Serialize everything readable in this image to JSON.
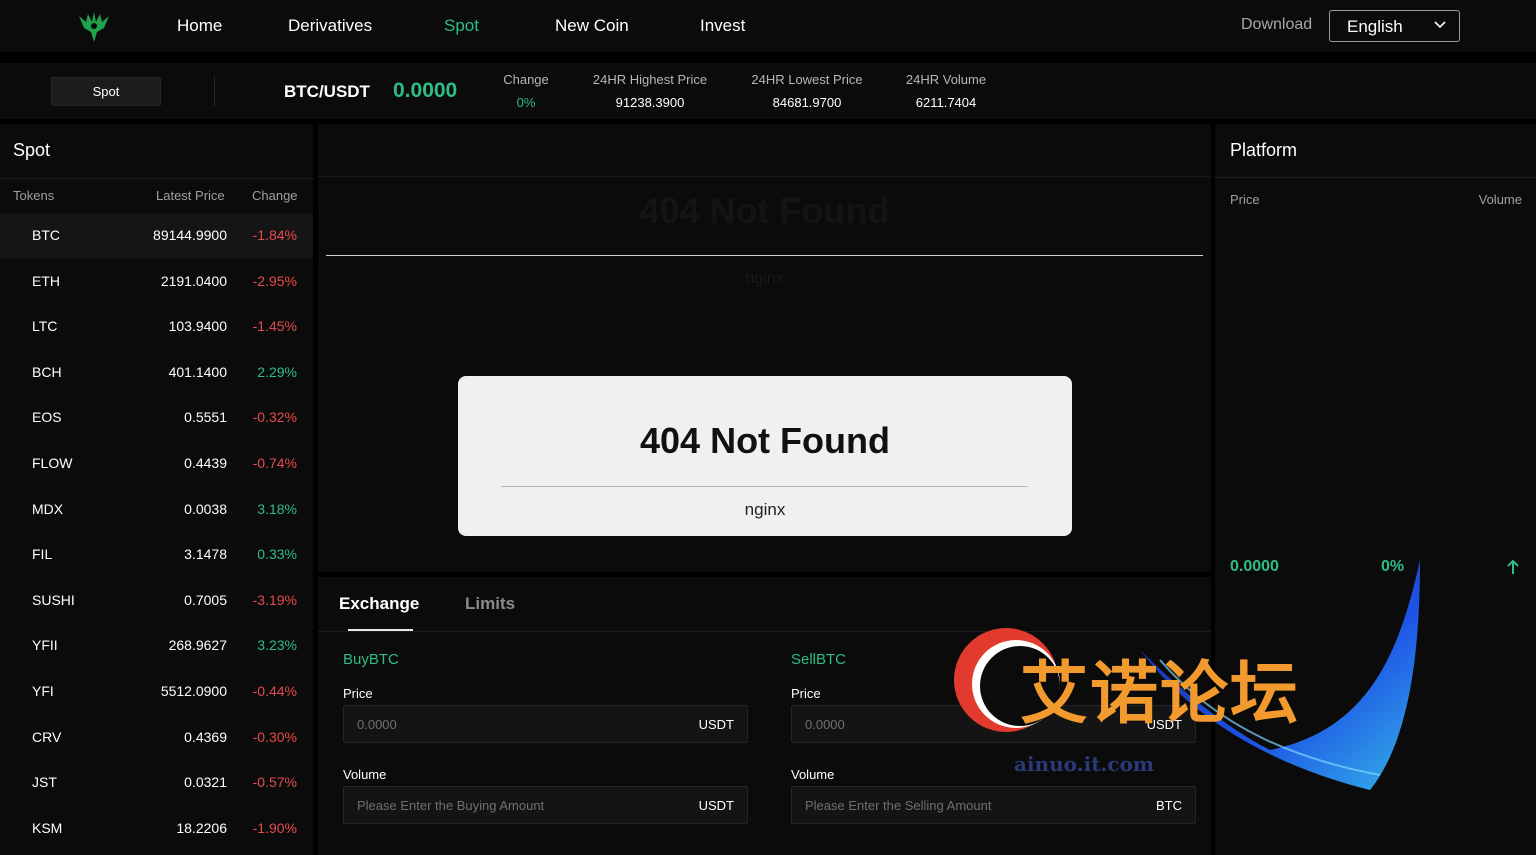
{
  "nav": {
    "items": [
      {
        "label": "Home",
        "active": false
      },
      {
        "label": "Derivatives",
        "active": false
      },
      {
        "label": "Spot",
        "active": true
      },
      {
        "label": "New Coin",
        "active": false
      },
      {
        "label": "Invest",
        "active": false
      }
    ],
    "download": "Download",
    "language": "English"
  },
  "ticker": {
    "tab": "Spot",
    "pair": "BTC/USDT",
    "price": "0.0000",
    "stats": [
      {
        "key": "Change",
        "value": "0%"
      },
      {
        "key": "24HR Highest Price",
        "value": "91238.3900"
      },
      {
        "key": "24HR Lowest Price",
        "value": "84681.9700"
      },
      {
        "key": "24HR Volume",
        "value": "6211.7404"
      }
    ]
  },
  "spot": {
    "title": "Spot",
    "columns": [
      "Tokens",
      "Latest Price",
      "Change"
    ],
    "rows": [
      {
        "symbol": "BTC",
        "price": "89144.9900",
        "change": "-1.84%",
        "dir": "down"
      },
      {
        "symbol": "ETH",
        "price": "2191.0400",
        "change": "-2.95%",
        "dir": "down"
      },
      {
        "symbol": "LTC",
        "price": "103.9400",
        "change": "-1.45%",
        "dir": "down"
      },
      {
        "symbol": "BCH",
        "price": "401.1400",
        "change": "2.29%",
        "dir": "up"
      },
      {
        "symbol": "EOS",
        "price": "0.5551",
        "change": "-0.32%",
        "dir": "down"
      },
      {
        "symbol": "FLOW",
        "price": "0.4439",
        "change": "-0.74%",
        "dir": "down"
      },
      {
        "symbol": "MDX",
        "price": "0.0038",
        "change": "3.18%",
        "dir": "up"
      },
      {
        "symbol": "FIL",
        "price": "3.1478",
        "change": "0.33%",
        "dir": "up"
      },
      {
        "symbol": "SUSHI",
        "price": "0.7005",
        "change": "-3.19%",
        "dir": "down"
      },
      {
        "symbol": "YFII",
        "price": "268.9627",
        "change": "3.23%",
        "dir": "up"
      },
      {
        "symbol": "YFI",
        "price": "5512.0900",
        "change": "-0.44%",
        "dir": "down"
      },
      {
        "symbol": "CRV",
        "price": "0.4369",
        "change": "-0.30%",
        "dir": "down"
      },
      {
        "symbol": "JST",
        "price": "0.0321",
        "change": "-0.57%",
        "dir": "down"
      },
      {
        "symbol": "KSM",
        "price": "18.2206",
        "change": "-1.90%",
        "dir": "down"
      }
    ]
  },
  "chart_area": {
    "ghost_title": "404 Not Found",
    "ghost_sub": "nginx",
    "error_title": "404 Not Found",
    "error_sub": "nginx"
  },
  "trade": {
    "tabs": [
      "Exchange",
      "Limits"
    ],
    "buy": {
      "title": "BuyBTC",
      "price_label": "Price",
      "price_placeholder": "0.0000",
      "price_unit": "USDT",
      "volume_label": "Volume",
      "volume_placeholder": "Please Enter the Buying Amount",
      "volume_unit": "USDT"
    },
    "sell": {
      "title": "SellBTC",
      "price_label": "Price",
      "price_placeholder": "0.0000",
      "price_unit": "USDT",
      "volume_label": "Volume",
      "volume_placeholder": "Please Enter the Selling Amount",
      "volume_unit": "BTC"
    }
  },
  "platform": {
    "title": "Platform",
    "col_price": "Price",
    "col_volume": "Volume",
    "price": "0.0000",
    "change": "0%"
  },
  "watermark": {
    "text": "艾诺论坛",
    "url": "ainuo.it.com"
  },
  "colors": {
    "accent_green": "#2ebd85",
    "negative_red": "#e54b4b",
    "panel_bg": "#0b0b0b"
  }
}
